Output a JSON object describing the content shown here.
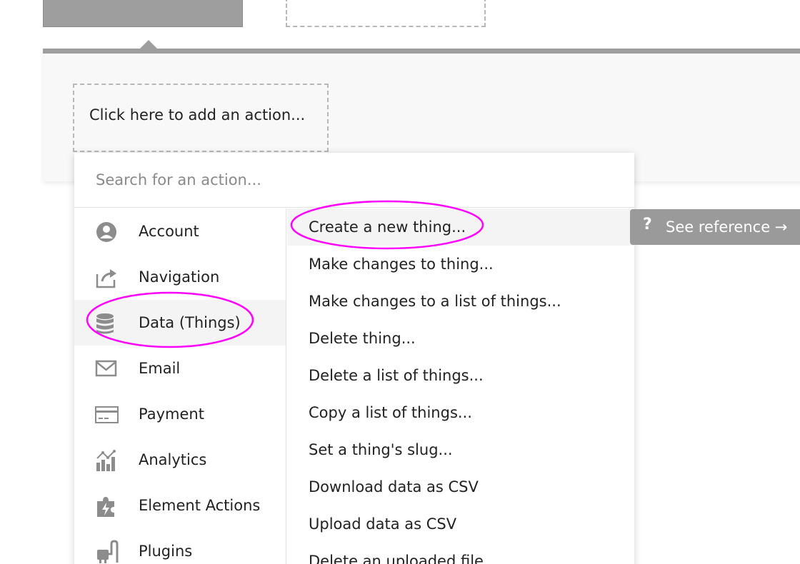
{
  "workflow": {
    "add_action_label": "Click here to add an action..."
  },
  "action_menu": {
    "search_placeholder": "Search for an action...",
    "categories": [
      {
        "label": "Account",
        "icon": "account-icon"
      },
      {
        "label": "Navigation",
        "icon": "navigation-icon"
      },
      {
        "label": "Data (Things)",
        "icon": "database-icon"
      },
      {
        "label": "Email",
        "icon": "email-icon"
      },
      {
        "label": "Payment",
        "icon": "payment-icon"
      },
      {
        "label": "Analytics",
        "icon": "analytics-icon"
      },
      {
        "label": "Element Actions",
        "icon": "element-actions-icon"
      },
      {
        "label": "Plugins",
        "icon": "plugins-icon"
      }
    ],
    "selected_category": "Data (Things)",
    "actions": [
      {
        "label": "Create a new thing..."
      },
      {
        "label": "Make changes to thing..."
      },
      {
        "label": "Make changes to a list of things..."
      },
      {
        "label": "Delete thing..."
      },
      {
        "label": "Delete a list of things..."
      },
      {
        "label": "Copy a list of things..."
      },
      {
        "label": "Set a thing's slug..."
      },
      {
        "label": "Download data as CSV"
      },
      {
        "label": "Upload data as CSV"
      },
      {
        "label": "Delete an uploaded file"
      }
    ],
    "highlighted_action": "Create a new thing..."
  },
  "reference": {
    "icon_glyph": "?",
    "label": "See reference →"
  },
  "colors": {
    "highlight_circle": "#ff00ff",
    "panel_bar": "#9e9e9e",
    "reference_bg": "#9a9a9a"
  }
}
